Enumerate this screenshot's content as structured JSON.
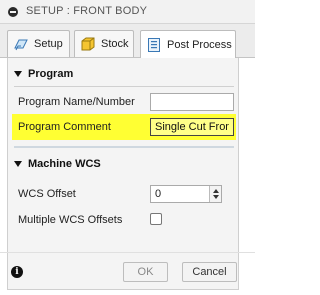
{
  "window": {
    "title": "SETUP : FRONT BODY"
  },
  "tabs": [
    {
      "label": "Setup",
      "icon": "setup-icon",
      "active": false
    },
    {
      "label": "Stock",
      "icon": "stock-icon",
      "active": false
    },
    {
      "label": "Post Process",
      "icon": "post-process-icon",
      "active": true
    }
  ],
  "program": {
    "header": "Program",
    "name_label": "Program Name/Number",
    "name_value": "",
    "comment_label": "Program Comment",
    "comment_value": "Single Cut Front",
    "highlight_color": "#ffff33"
  },
  "machine_wcs": {
    "header": "Machine WCS",
    "offset_label": "WCS Offset",
    "offset_value": "0",
    "multiple_label": "Multiple WCS Offsets",
    "multiple_checked": false
  },
  "footer": {
    "ok_label": "OK",
    "cancel_label": "Cancel",
    "info_icon": "info-icon"
  }
}
